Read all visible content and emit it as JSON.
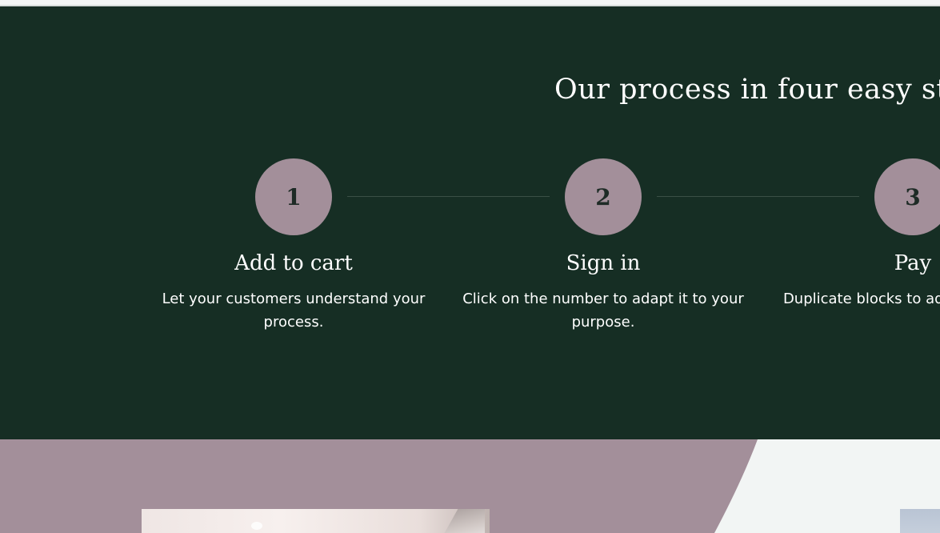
{
  "process": {
    "title": "Our process in four easy steps",
    "steps": [
      {
        "number": "1",
        "title": "Add to cart",
        "text": "Let your customers understand your process."
      },
      {
        "number": "2",
        "title": "Sign in",
        "text": "Click on the number to adapt it to your purpose."
      },
      {
        "number": "3",
        "title": "Pay",
        "text": "Duplicate blocks to add more steps."
      }
    ]
  },
  "colors": {
    "section_background": "#162e24",
    "step_circle": "#a38f9a",
    "accent_mauve": "#a38f9a",
    "light_background": "#f2f5f4"
  }
}
